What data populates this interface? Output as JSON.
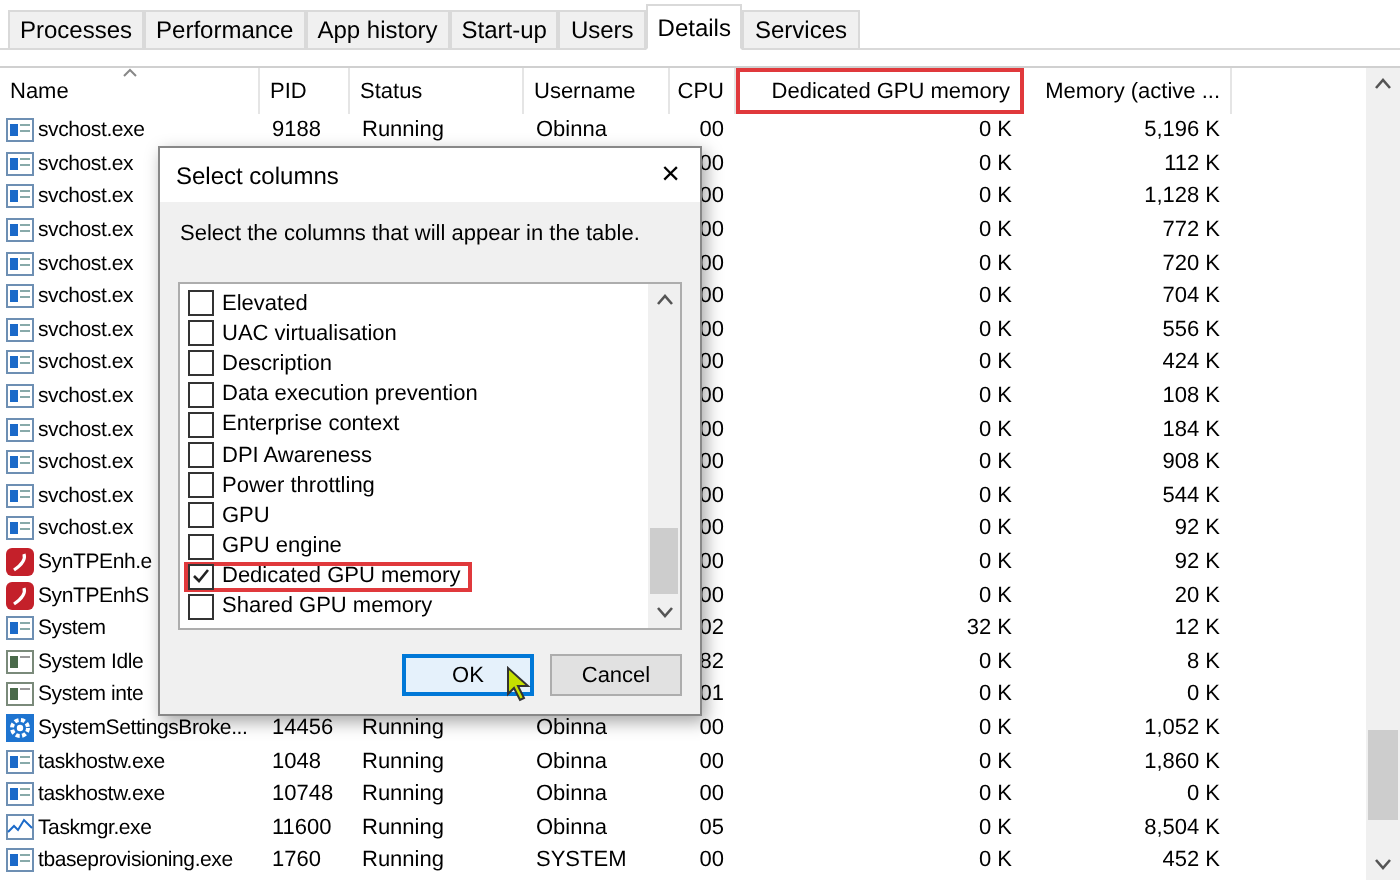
{
  "tabs": [
    {
      "label": "Processes",
      "selected": false
    },
    {
      "label": "Performance",
      "selected": false
    },
    {
      "label": "App history",
      "selected": false
    },
    {
      "label": "Start-up",
      "selected": false
    },
    {
      "label": "Users",
      "selected": false
    },
    {
      "label": "Details",
      "selected": true
    },
    {
      "label": "Services",
      "selected": false
    }
  ],
  "table": {
    "columns": [
      {
        "label": "Name",
        "highlighted": false,
        "sorted": true
      },
      {
        "label": "PID",
        "highlighted": false,
        "sorted": false
      },
      {
        "label": "Status",
        "highlighted": false,
        "sorted": false
      },
      {
        "label": "Username",
        "highlighted": false,
        "sorted": false
      },
      {
        "label": "CPU",
        "highlighted": false,
        "sorted": false
      },
      {
        "label": "Dedicated GPU memory",
        "highlighted": true,
        "sorted": false
      },
      {
        "label": "Memory (active ...",
        "highlighted": false,
        "sorted": false
      }
    ],
    "rows": [
      {
        "kind": "app",
        "name": "svchost.exe",
        "pid": "9188",
        "status": "Running",
        "username": "Obinna",
        "cpu": "00",
        "gpu": "0 K",
        "memory": "5,196 K"
      },
      {
        "kind": "app",
        "name": "svchost.ex",
        "cpu": "00",
        "gpu": "0 K",
        "memory": "112 K"
      },
      {
        "kind": "app",
        "name": "svchost.ex",
        "cpu": "00",
        "gpu": "0 K",
        "memory": "1,128 K"
      },
      {
        "kind": "app",
        "name": "svchost.ex",
        "cpu": "00",
        "gpu": "0 K",
        "memory": "772 K"
      },
      {
        "kind": "app",
        "name": "svchost.ex",
        "cpu": "00",
        "gpu": "0 K",
        "memory": "720 K"
      },
      {
        "kind": "app",
        "name": "svchost.ex",
        "cpu": "00",
        "gpu": "0 K",
        "memory": "704 K"
      },
      {
        "kind": "app",
        "name": "svchost.ex",
        "cpu": "00",
        "gpu": "0 K",
        "memory": "556 K"
      },
      {
        "kind": "app",
        "name": "svchost.ex",
        "cpu": "00",
        "gpu": "0 K",
        "memory": "424 K"
      },
      {
        "kind": "app",
        "name": "svchost.ex",
        "cpu": "00",
        "gpu": "0 K",
        "memory": "108 K"
      },
      {
        "kind": "app",
        "name": "svchost.ex",
        "cpu": "00",
        "gpu": "0 K",
        "memory": "184 K"
      },
      {
        "kind": "app",
        "name": "svchost.ex",
        "cpu": "00",
        "gpu": "0 K",
        "memory": "908 K"
      },
      {
        "kind": "app",
        "name": "svchost.ex",
        "cpu": "00",
        "gpu": "0 K",
        "memory": "544 K"
      },
      {
        "kind": "app",
        "name": "svchost.ex",
        "cpu": "00",
        "gpu": "0 K",
        "memory": "92 K"
      },
      {
        "kind": "synaptics",
        "name": "SynTPEnh.e",
        "cpu": "00",
        "gpu": "0 K",
        "memory": "92 K"
      },
      {
        "kind": "synaptics",
        "name": "SynTPEnhS",
        "cpu": "00",
        "gpu": "0 K",
        "memory": "20 K"
      },
      {
        "kind": "app",
        "name": "System",
        "cpu": "02",
        "gpu": "32 K",
        "memory": "12 K"
      },
      {
        "kind": "system",
        "name": "System Idle",
        "cpu": "82",
        "gpu": "0 K",
        "memory": "8 K"
      },
      {
        "kind": "system",
        "name": "System inte",
        "cpu": "01",
        "gpu": "0 K",
        "memory": "0 K"
      },
      {
        "kind": "gear",
        "name": "SystemSettingsBroke...",
        "pid": "14456",
        "status": "Running",
        "username": "Obinna",
        "cpu": "00",
        "gpu": "0 K",
        "memory": "1,052 K"
      },
      {
        "kind": "app",
        "name": "taskhostw.exe",
        "pid": "1048",
        "status": "Running",
        "username": "Obinna",
        "cpu": "00",
        "gpu": "0 K",
        "memory": "1,860 K"
      },
      {
        "kind": "app",
        "name": "taskhostw.exe",
        "pid": "10748",
        "status": "Running",
        "username": "Obinna",
        "cpu": "00",
        "gpu": "0 K",
        "memory": "0 K"
      },
      {
        "kind": "chart",
        "name": "Taskmgr.exe",
        "pid": "11600",
        "status": "Running",
        "username": "Obinna",
        "cpu": "05",
        "gpu": "0 K",
        "memory": "8,504 K"
      },
      {
        "kind": "app",
        "name": "tbaseprovisioning.exe",
        "pid": "1760",
        "status": "Running",
        "username": "SYSTEM",
        "cpu": "00",
        "gpu": "0 K",
        "memory": "452 K"
      }
    ]
  },
  "dialog": {
    "title": "Select columns",
    "close": "×",
    "description": "Select the columns that will appear in the table.",
    "options": [
      {
        "label": "Elevated",
        "checked": false,
        "highlighted": false
      },
      {
        "label": "UAC virtualisation",
        "checked": false,
        "highlighted": false
      },
      {
        "label": "Description",
        "checked": false,
        "highlighted": false
      },
      {
        "label": "Data execution prevention",
        "checked": false,
        "highlighted": false
      },
      {
        "label": "Enterprise context",
        "checked": false,
        "highlighted": false
      },
      {
        "label": "DPI Awareness",
        "checked": false,
        "highlighted": false
      },
      {
        "label": "Power throttling",
        "checked": false,
        "highlighted": false
      },
      {
        "label": "GPU",
        "checked": false,
        "highlighted": false
      },
      {
        "label": "GPU engine",
        "checked": false,
        "highlighted": false
      },
      {
        "label": "Dedicated GPU memory",
        "checked": true,
        "highlighted": true
      },
      {
        "label": "Shared GPU memory",
        "checked": false,
        "highlighted": false
      }
    ],
    "buttons": [
      {
        "label": "OK",
        "focused": true
      },
      {
        "label": "Cancel",
        "focused": false
      }
    ]
  }
}
